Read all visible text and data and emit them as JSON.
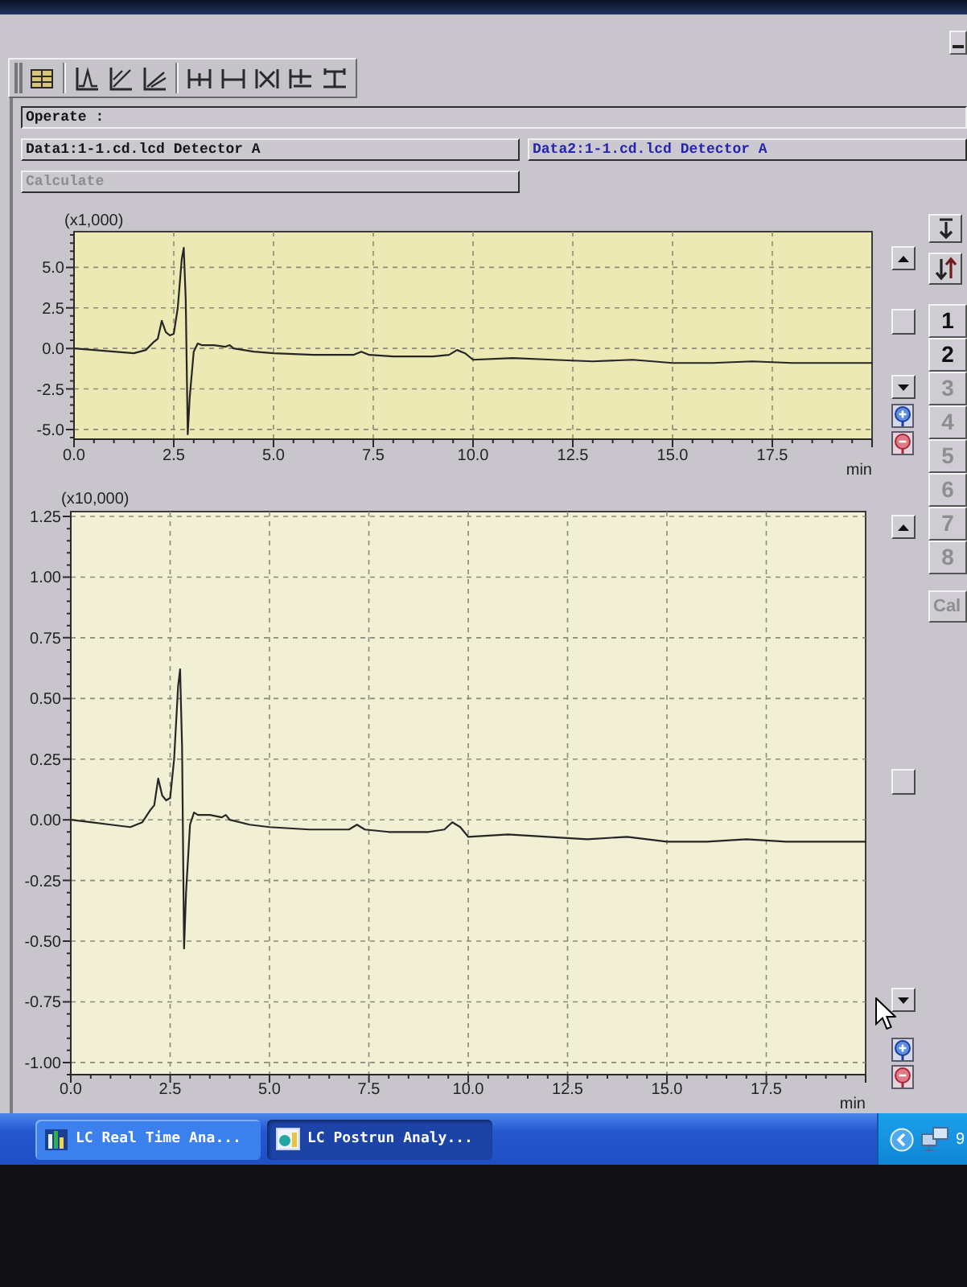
{
  "header": {
    "operate_label": "Operate :",
    "data_views": [
      {
        "label": "Data1:1-1.cd.lcd Detector A",
        "selected": false
      },
      {
        "label": "Data2:1-1.cd.lcd Detector A",
        "selected": true
      }
    ],
    "calculate_button": {
      "label": "Calculate",
      "disabled": true
    }
  },
  "charts": [
    {
      "chart_data": {
        "type": "line",
        "grid": true,
        "xlabel": "min",
        "ylabel": "(x1,000)",
        "x": [
          0,
          0.5,
          1.0,
          1.5,
          1.8,
          2.0,
          2.1,
          2.2,
          2.3,
          2.4,
          2.5,
          2.6,
          2.7,
          2.75,
          2.8,
          2.85,
          2.9,
          3.0,
          3.1,
          3.2,
          3.5,
          3.8,
          3.9,
          4.0,
          4.5,
          5.0,
          6.0,
          7.0,
          7.2,
          7.4,
          8.0,
          9.0,
          9.4,
          9.6,
          9.8,
          10.0,
          11.0,
          12.0,
          13.0,
          14.0,
          15.0,
          16.0,
          17.0,
          18.0,
          19.0,
          20.0
        ],
        "values": [
          0.0,
          -0.1,
          -0.2,
          -0.3,
          -0.1,
          0.4,
          0.6,
          1.7,
          1.0,
          0.8,
          0.9,
          2.5,
          5.5,
          6.2,
          3.0,
          -5.3,
          -3.0,
          -0.2,
          0.3,
          0.2,
          0.2,
          0.1,
          0.2,
          0.0,
          -0.2,
          -0.3,
          -0.4,
          -0.4,
          -0.2,
          -0.4,
          -0.5,
          -0.5,
          -0.4,
          -0.1,
          -0.3,
          -0.7,
          -0.6,
          -0.7,
          -0.8,
          -0.7,
          -0.9,
          -0.9,
          -0.8,
          -0.9,
          -0.9,
          -0.9
        ],
        "xlim": [
          0,
          20
        ],
        "ylim": [
          -5.6,
          7.2
        ],
        "xticks": [
          {
            "value": 0,
            "label": "0.0"
          },
          {
            "value": 2.5,
            "label": "2.5"
          },
          {
            "value": 5,
            "label": "5.0"
          },
          {
            "value": 7.5,
            "label": "7.5"
          },
          {
            "value": 10,
            "label": "10.0"
          },
          {
            "value": 12.5,
            "label": "12.5"
          },
          {
            "value": 15,
            "label": "15.0"
          },
          {
            "value": 17.5,
            "label": "17.5"
          }
        ],
        "yticks": [
          {
            "value": -5,
            "label": "-5.0"
          },
          {
            "value": -2.5,
            "label": "-2.5"
          },
          {
            "value": 0,
            "label": "0.0"
          },
          {
            "value": 2.5,
            "label": "2.5"
          },
          {
            "value": 5,
            "label": "5.0"
          }
        ]
      }
    },
    {
      "chart_data": {
        "type": "line",
        "grid": true,
        "xlabel": "min",
        "ylabel": "(x10,000)",
        "x": [
          0,
          0.5,
          1.0,
          1.5,
          1.8,
          2.0,
          2.1,
          2.2,
          2.3,
          2.4,
          2.5,
          2.6,
          2.7,
          2.75,
          2.8,
          2.85,
          2.9,
          3.0,
          3.1,
          3.2,
          3.5,
          3.8,
          3.9,
          4.0,
          4.5,
          5.0,
          6.0,
          7.0,
          7.2,
          7.4,
          8.0,
          9.0,
          9.4,
          9.6,
          9.8,
          10.0,
          11.0,
          12.0,
          13.0,
          14.0,
          15.0,
          16.0,
          17.0,
          18.0,
          19.0,
          20.0
        ],
        "values": [
          0.0,
          -0.01,
          -0.02,
          -0.03,
          -0.01,
          0.04,
          0.06,
          0.17,
          0.1,
          0.08,
          0.09,
          0.25,
          0.55,
          0.62,
          0.3,
          -0.53,
          -0.3,
          -0.02,
          0.03,
          0.02,
          0.02,
          0.01,
          0.02,
          0.0,
          -0.02,
          -0.03,
          -0.04,
          -0.04,
          -0.02,
          -0.04,
          -0.05,
          -0.05,
          -0.04,
          -0.01,
          -0.03,
          -0.07,
          -0.06,
          -0.07,
          -0.08,
          -0.07,
          -0.09,
          -0.09,
          -0.08,
          -0.09,
          -0.09,
          -0.09
        ],
        "xlim": [
          0,
          20
        ],
        "ylim": [
          -1.05,
          1.27
        ],
        "xticks": [
          {
            "value": 0,
            "label": "0.0"
          },
          {
            "value": 2.5,
            "label": "2.5"
          },
          {
            "value": 5,
            "label": "5.0"
          },
          {
            "value": 7.5,
            "label": "7.5"
          },
          {
            "value": 10,
            "label": "10.0"
          },
          {
            "value": 12.5,
            "label": "12.5"
          },
          {
            "value": 15,
            "label": "15.0"
          },
          {
            "value": 17.5,
            "label": "17.5"
          }
        ],
        "yticks": [
          {
            "value": -1,
            "label": "-1.00"
          },
          {
            "value": -0.75,
            "label": "-0.75"
          },
          {
            "value": -0.5,
            "label": "-0.50"
          },
          {
            "value": -0.25,
            "label": "-0.25"
          },
          {
            "value": 0,
            "label": "0.00"
          },
          {
            "value": 0.25,
            "label": "0.25"
          },
          {
            "value": 0.5,
            "label": "0.50"
          },
          {
            "value": 0.75,
            "label": "0.75"
          },
          {
            "value": 1,
            "label": "1.00"
          },
          {
            "value": 1.25,
            "label": "1.25"
          }
        ]
      }
    }
  ],
  "side_panel": {
    "slots": [
      {
        "label": "1",
        "disabled": false
      },
      {
        "label": "2",
        "disabled": false
      },
      {
        "label": "3",
        "disabled": true
      },
      {
        "label": "4",
        "disabled": true
      },
      {
        "label": "5",
        "disabled": true
      },
      {
        "label": "6",
        "disabled": true
      },
      {
        "label": "7",
        "disabled": true
      },
      {
        "label": "8",
        "disabled": true
      }
    ],
    "cal_button": {
      "label": "Cal",
      "disabled": true
    }
  },
  "taskbar": {
    "items": [
      {
        "label": "LC Real Time Ana...",
        "selected": false
      },
      {
        "label": "LC Postrun Analy...",
        "selected": true
      }
    ],
    "clock": "9"
  }
}
